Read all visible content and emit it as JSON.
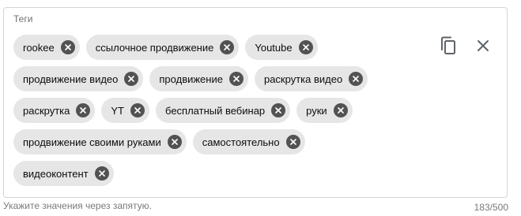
{
  "field": {
    "label": "Теги",
    "helper_text": "Укажите значения через запятую.",
    "counter": "183/500"
  },
  "tags": [
    [
      "rookee",
      "ссылочное продвижение",
      "Youtube"
    ],
    [
      "продвижение видео",
      "продвижение",
      "раскрутка видео"
    ],
    [
      "раскрутка",
      "YT",
      "бесплатный вебинар",
      "руки"
    ],
    [
      "продвижение своими руками",
      "самостоятельно"
    ],
    [
      "видеоконтент"
    ]
  ],
  "icons": {
    "copy": "copy-icon",
    "clear": "close-icon",
    "chip_remove": "cancel-circle-icon"
  },
  "colors": {
    "chip_background": "#e6e6e6",
    "chip_remove_background": "#525252",
    "icon_color": "#5f6368",
    "border": "#d5d5d5"
  }
}
